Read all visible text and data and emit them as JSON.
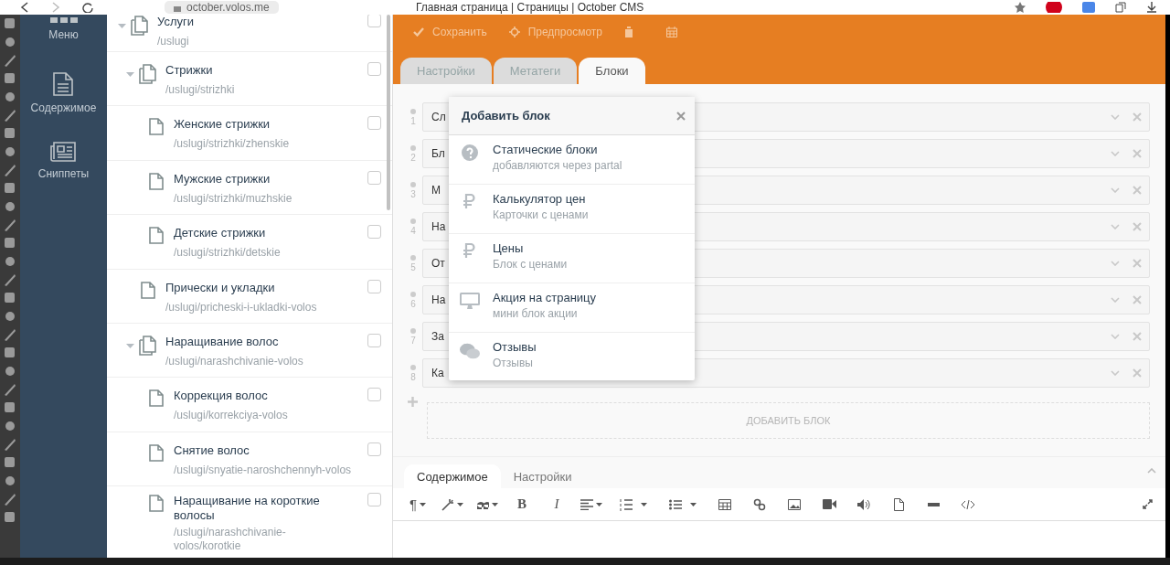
{
  "browser": {
    "url": "october.volos.me",
    "title": "Главная страница | Страницы | October CMS"
  },
  "sidebar": {
    "items": [
      {
        "label": "Меню"
      },
      {
        "label": "Содержимое"
      },
      {
        "label": "Сниппеты"
      }
    ]
  },
  "tree": {
    "items": [
      {
        "title": "Услуги",
        "path": "/uslugi",
        "checked": false,
        "expanded": true,
        "children": [
          {
            "title": "Стрижки",
            "path": "/uslugi/strizhki",
            "checked": false,
            "expanded": true,
            "children": [
              {
                "title": "Женские стрижки",
                "path": "/uslugi/strizhki/zhenskie",
                "checked": false
              },
              {
                "title": "Мужские стрижки",
                "path": "/uslugi/strizhki/muzhskie",
                "checked": false
              },
              {
                "title": "Детские стрижки",
                "path": "/uslugi/strizhki/detskie",
                "checked": false
              }
            ]
          },
          {
            "title": "Прически и укладки",
            "path": "/uslugi/pricheski-i-ukladki-volos",
            "checked": false
          },
          {
            "title": "Наращивание волос",
            "path": "/uslugi/narashchivanie-volos",
            "checked": false,
            "expanded": true,
            "children": [
              {
                "title": "Коррекция волос",
                "path": "/uslugi/korrekciya-volos",
                "checked": false
              },
              {
                "title": "Снятие волос",
                "path": "/uslugi/snyatie-naroshchennyh-volos",
                "checked": false
              },
              {
                "title": "Наращивание на короткие волосы",
                "path": "/uslugi/narashchivanie-volos/korotkie",
                "checked": false
              }
            ]
          }
        ]
      }
    ]
  },
  "toolbar": {
    "buttons": [
      {
        "label": "Сохранить"
      },
      {
        "label": "Предпросмотр"
      }
    ]
  },
  "tabs": [
    {
      "label": "Настройки",
      "selected": false
    },
    {
      "label": "Метатеги",
      "selected": false
    },
    {
      "label": "Блоки",
      "selected": true
    }
  ],
  "blocks": {
    "rows": [
      {
        "number": "1",
        "value": "Сл"
      },
      {
        "number": "2",
        "value": "Бл"
      },
      {
        "number": "3",
        "value": "М"
      },
      {
        "number": "4",
        "value": "На"
      },
      {
        "number": "5",
        "value": "От"
      },
      {
        "number": "6",
        "value": "На"
      },
      {
        "number": "7",
        "value": "За"
      },
      {
        "number": "8",
        "value": "Ка"
      }
    ],
    "add_label": "ДОБАВИТЬ БЛОК"
  },
  "popup": {
    "title": "Добавить блок",
    "items": [
      {
        "title": "Статические блоки",
        "subtitle": "добавляются через partal"
      },
      {
        "title": "Калькулятор цен",
        "subtitle": "Карточки с ценами"
      },
      {
        "title": "Цены",
        "subtitle": "Блок с ценами"
      },
      {
        "title": "Акция на страницу",
        "subtitle": "мини блок акции"
      },
      {
        "title": "Отзывы",
        "subtitle": "Отзывы"
      }
    ]
  },
  "editor": {
    "tabs": [
      {
        "label": "Содержимое",
        "selected": true
      },
      {
        "label": "Настройки",
        "selected": false
      }
    ],
    "format_labels": [
      "¶",
      "B",
      "I"
    ]
  }
}
